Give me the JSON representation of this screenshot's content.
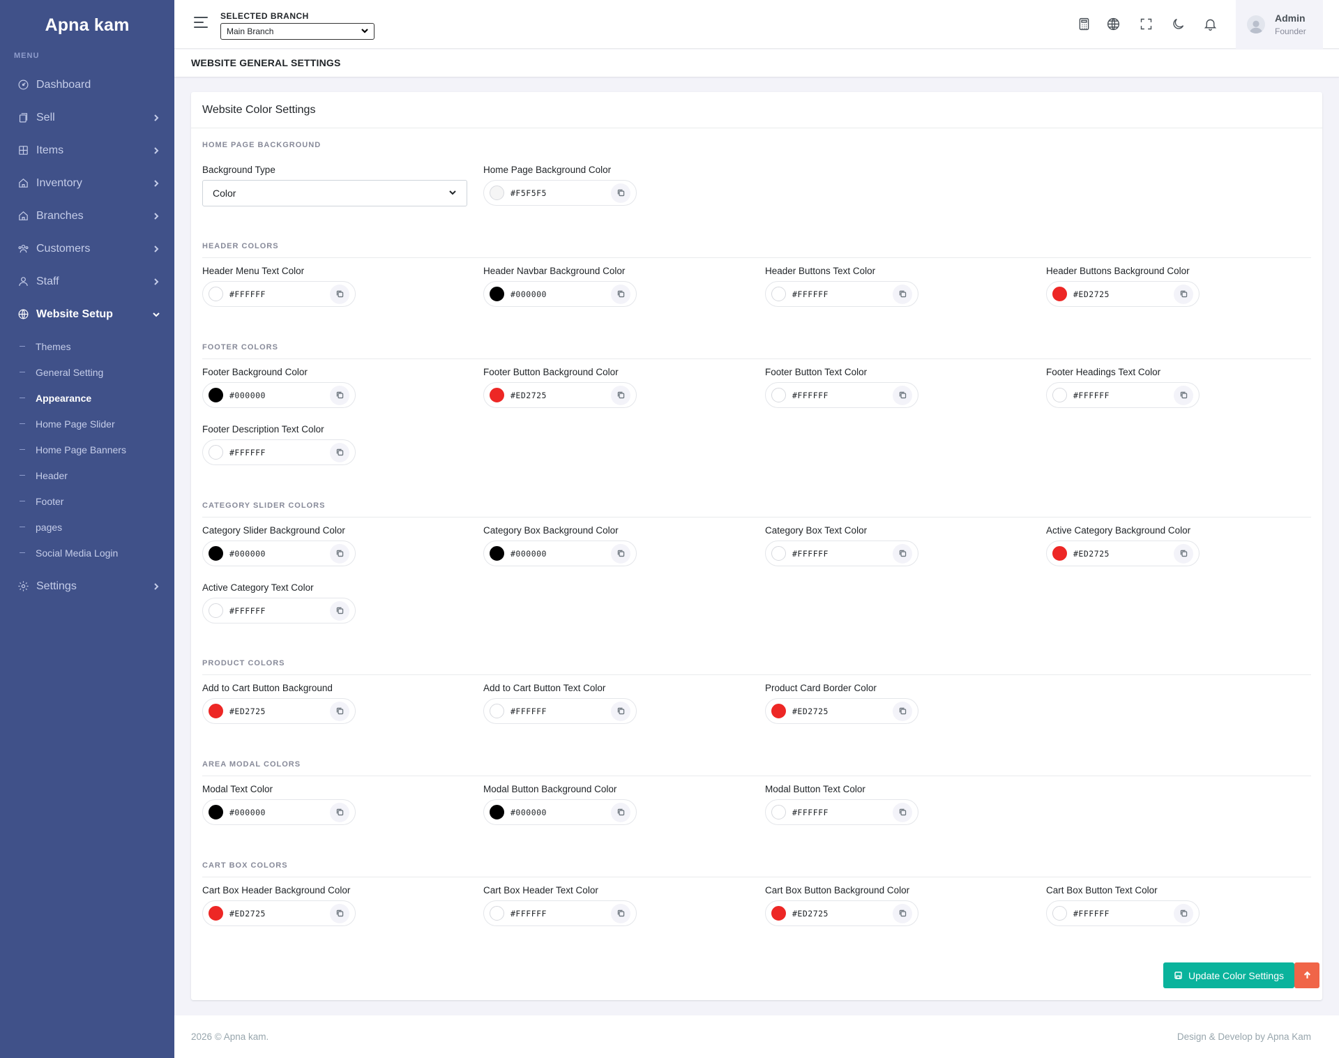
{
  "app": {
    "brand": "Apna kam",
    "menu_title": "MENU"
  },
  "sidebar": {
    "items": [
      {
        "label": "Dashboard",
        "icon": "dashboard-icon",
        "has_arrow": false
      },
      {
        "label": "Sell",
        "icon": "sell-icon",
        "has_arrow": true
      },
      {
        "label": "Items",
        "icon": "grid-icon",
        "has_arrow": true
      },
      {
        "label": "Inventory",
        "icon": "home-icon",
        "has_arrow": true
      },
      {
        "label": "Branches",
        "icon": "home-icon",
        "has_arrow": true
      },
      {
        "label": "Customers",
        "icon": "users-icon",
        "has_arrow": true
      },
      {
        "label": "Staff",
        "icon": "user-icon",
        "has_arrow": true
      },
      {
        "label": "Website Setup",
        "icon": "globe-icon",
        "has_arrow": true,
        "expanded": true
      },
      {
        "label": "Settings",
        "icon": "gear-icon",
        "has_arrow": true
      }
    ],
    "website_setup_sub": [
      {
        "label": "Themes",
        "active": false
      },
      {
        "label": "General Setting",
        "active": false
      },
      {
        "label": "Appearance",
        "active": true
      },
      {
        "label": "Home Page Slider",
        "active": false
      },
      {
        "label": "Home Page Banners",
        "active": false
      },
      {
        "label": "Header",
        "active": false
      },
      {
        "label": "Footer",
        "active": false
      },
      {
        "label": "pages",
        "active": false
      },
      {
        "label": "Social Media Login",
        "active": false
      }
    ]
  },
  "topbar": {
    "branch_label": "SELECTED BRANCH",
    "branch_value": "Main Branch",
    "icons": [
      "calculator-icon",
      "globe-icon",
      "fullscreen-icon",
      "moon-icon",
      "bell-icon"
    ],
    "user": {
      "name": "Admin",
      "role": "Founder"
    }
  },
  "page": {
    "title": "WEBSITE GENERAL SETTINGS",
    "card_title": "Website Color Settings"
  },
  "sections": {
    "home": {
      "title": "HOME PAGE BACKGROUND",
      "bg_type_label": "Background Type",
      "bg_type_value": "Color",
      "bg_color_label": "Home Page Background Color",
      "bg_color_value": "#F5F5F5"
    },
    "header": {
      "title": "HEADER COLORS",
      "fields": [
        {
          "label": "Header Menu Text Color",
          "value": "#FFFFFF"
        },
        {
          "label": "Header Navbar Background Color",
          "value": "#000000"
        },
        {
          "label": "Header Buttons Text Color",
          "value": "#FFFFFF"
        },
        {
          "label": "Header Buttons Background Color",
          "value": "#ED2725"
        }
      ]
    },
    "footer": {
      "title": "FOOTER COLORS",
      "fields": [
        {
          "label": "Footer Background Color",
          "value": "#000000"
        },
        {
          "label": "Footer Button Background Color",
          "value": "#ED2725"
        },
        {
          "label": "Footer Button Text Color",
          "value": "#FFFFFF"
        },
        {
          "label": "Footer Headings Text Color",
          "value": "#FFFFFF"
        },
        {
          "label": "Footer Description Text Color",
          "value": "#FFFFFF"
        }
      ]
    },
    "category": {
      "title": "CATEGORY SLIDER COLORS",
      "fields": [
        {
          "label": "Category Slider Background Color",
          "value": "#000000"
        },
        {
          "label": "Category Box Background Color",
          "value": "#000000"
        },
        {
          "label": "Category Box Text Color",
          "value": "#FFFFFF"
        },
        {
          "label": "Active Category Background Color",
          "value": "#ED2725"
        },
        {
          "label": "Active Category Text Color",
          "value": "#FFFFFF"
        }
      ]
    },
    "product": {
      "title": "PRODUCT COLORS",
      "fields": [
        {
          "label": "Add to Cart Button Background",
          "value": "#ED2725"
        },
        {
          "label": "Add to Cart Button Text Color",
          "value": "#FFFFFF"
        },
        {
          "label": "Product Card Border Color",
          "value": "#ED2725"
        }
      ]
    },
    "modal": {
      "title": "AREA MODAL COLORS",
      "fields": [
        {
          "label": "Modal Text Color",
          "value": "#000000"
        },
        {
          "label": "Modal Button Background Color",
          "value": "#000000"
        },
        {
          "label": "Modal Button Text Color",
          "value": "#FFFFFF"
        }
      ]
    },
    "cart": {
      "title": "CART BOX COLORS",
      "fields": [
        {
          "label": "Cart Box Header Background Color",
          "value": "#ED2725"
        },
        {
          "label": "Cart Box Header Text Color",
          "value": "#FFFFFF"
        },
        {
          "label": "Cart Box Button Background Color",
          "value": "#ED2725"
        },
        {
          "label": "Cart Box Button Text Color",
          "value": "#FFFFFF"
        }
      ]
    }
  },
  "actions": {
    "update_label": "Update Color Settings"
  },
  "footer": {
    "left": "2026 © Apna kam.",
    "right": "Design & Develop by Apna Kam"
  },
  "colors": {
    "sidebar": "#405189",
    "accent_green": "#0ab39c",
    "accent_orange": "#f06548",
    "brand_red": "#ED2725"
  }
}
